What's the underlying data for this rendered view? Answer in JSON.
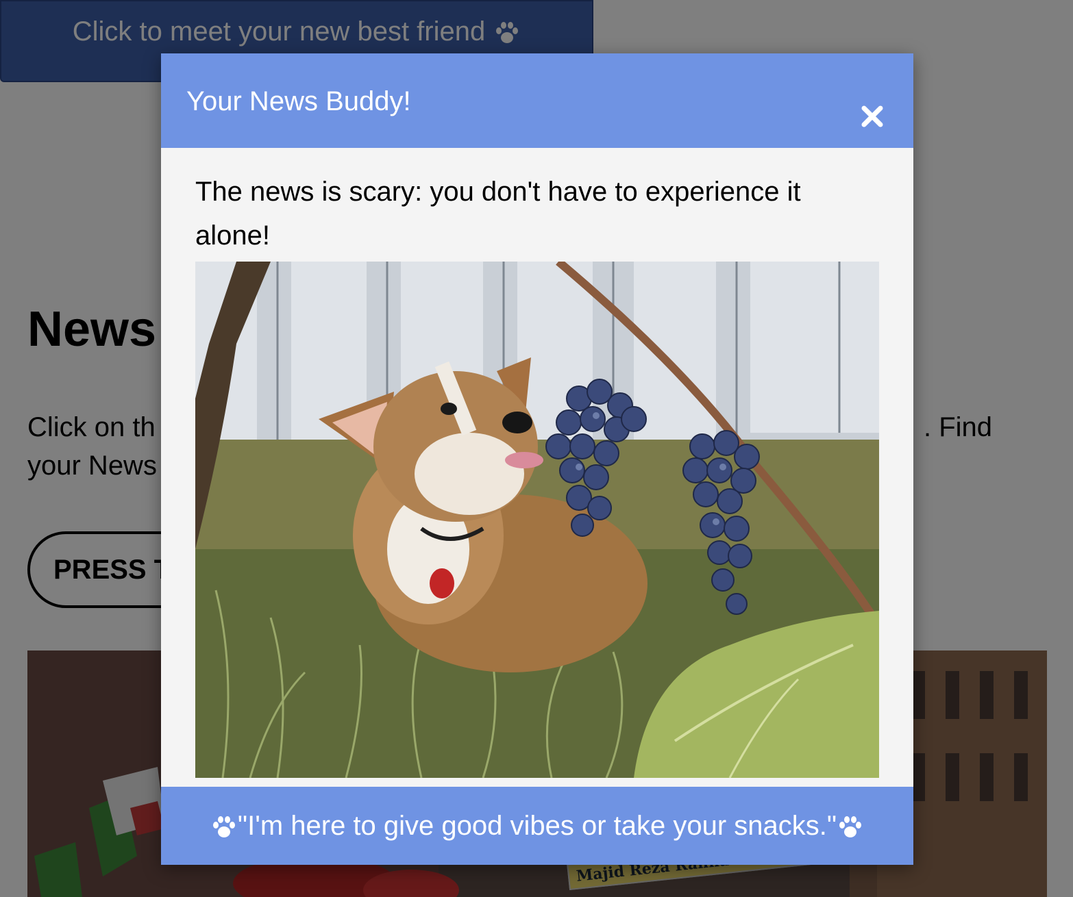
{
  "background_page": {
    "top_button_label": "Click to meet your new best friend",
    "heading": "News",
    "intro_left_line1": "Click on th",
    "intro_left_line2": "your News",
    "intro_right": ". Find",
    "press_button_label": "PRESS T",
    "photo_sign_text": "Majid Reza Rahnavard-Mashhad"
  },
  "modal": {
    "title": "Your News Buddy!",
    "close_symbol": "✕",
    "message": "The news is scary: you don't have to experience it alone!",
    "image_alt": "Corgi licking a bunch of grapes",
    "footer_quote": "\"I'm here to give good vibes or take your snacks.\""
  },
  "colors": {
    "modal_header": "#6f93e3",
    "top_button": "#3d5fa8",
    "modal_body": "#f4f4f4"
  },
  "icons": [
    "paw-icon",
    "close-icon"
  ]
}
